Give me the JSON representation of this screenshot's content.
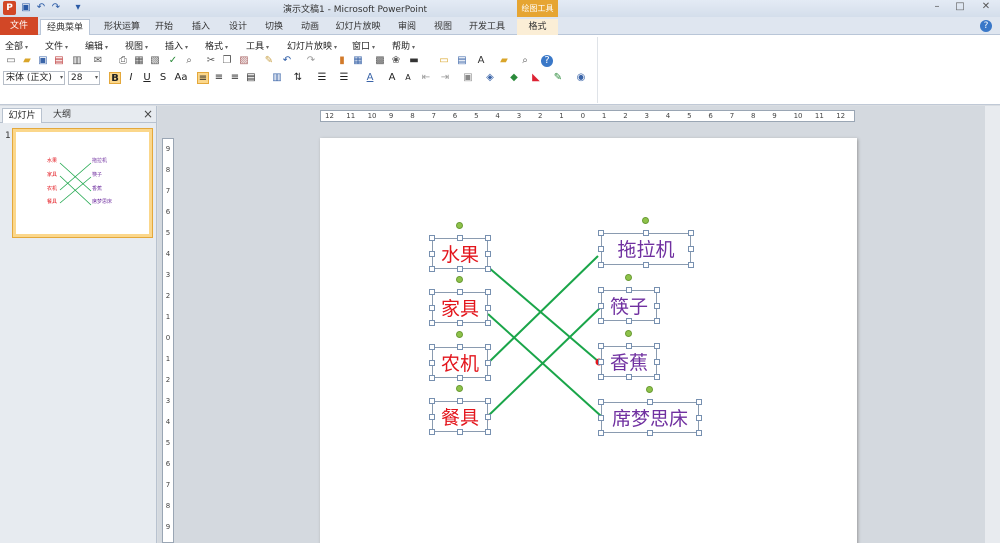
{
  "app": {
    "window_title": "演示文稿1 - Microsoft PowerPoint",
    "context_tool": "绘图工具",
    "icon_letter": "P"
  },
  "tabs": {
    "file": "文件",
    "items": [
      "经典菜单",
      "形状运算",
      "开始",
      "插入",
      "设计",
      "切换",
      "动画",
      "幻灯片放映",
      "审阅",
      "视图",
      "开发工具",
      "格式"
    ]
  },
  "menubar": [
    "全部",
    "文件",
    "编辑",
    "视图",
    "插入",
    "格式",
    "工具",
    "幻灯片放映",
    "窗口",
    "帮助"
  ],
  "font": {
    "name": "宋体 (正文)",
    "size": "28"
  },
  "format_buttons": [
    "B",
    "I",
    "U",
    "S",
    "Aa"
  ],
  "panel": {
    "tab_slides": "幻灯片",
    "tab_outline": "大纲",
    "close": "×",
    "slide_number": "1"
  },
  "slide": {
    "left_items": [
      "水果",
      "家具",
      "农机",
      "餐具"
    ],
    "right_items": [
      "拖拉机",
      "筷子",
      "香蕉",
      "席梦思床"
    ],
    "matches": [
      {
        "from": "水果",
        "to": "香蕉"
      },
      {
        "from": "家具",
        "to": "席梦思床"
      },
      {
        "from": "农机",
        "to": "拖拉机"
      },
      {
        "from": "餐具",
        "to": "筷子"
      }
    ],
    "left_color": "#e3151c",
    "right_color": "#7030a0",
    "line_color": "#1aa549"
  },
  "ruler_labels": [
    "12",
    "11",
    "10",
    "9",
    "8",
    "7",
    "6",
    "5",
    "4",
    "3",
    "2",
    "1",
    "0",
    "1",
    "2",
    "3",
    "4",
    "5",
    "6",
    "7",
    "8",
    "9",
    "10",
    "11",
    "12"
  ],
  "vruler_labels": [
    "9",
    "8",
    "7",
    "6",
    "5",
    "4",
    "3",
    "2",
    "1",
    "0",
    "1",
    "2",
    "3",
    "4",
    "5",
    "6",
    "7",
    "8",
    "9"
  ]
}
